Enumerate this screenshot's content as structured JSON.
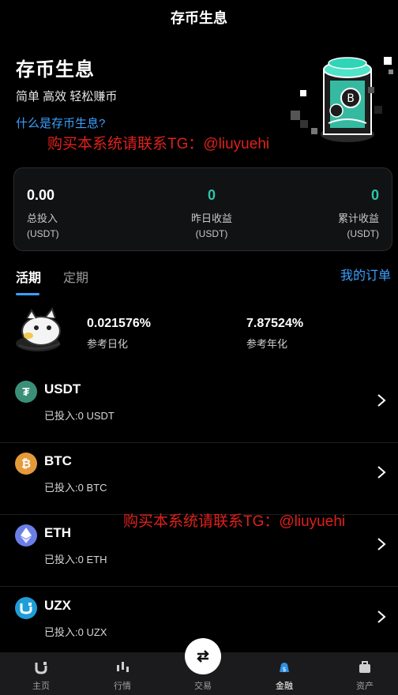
{
  "header": {
    "title": "存币生息"
  },
  "hero": {
    "title": "存币生息",
    "subtitle": "简单 高效 轻松赚币",
    "link": "什么是存币生息?",
    "watermark": "购买本系统请联系TG：@liuyuehi"
  },
  "stats": [
    {
      "value": "0.00",
      "label": "总投入",
      "unit": "(USDT)"
    },
    {
      "value": "0",
      "label": "昨日收益",
      "unit": "(USDT)"
    },
    {
      "value": "0",
      "label": "累计收益",
      "unit": "(USDT)"
    }
  ],
  "tabs": [
    {
      "label": "活期",
      "active": true
    },
    {
      "label": "定期",
      "active": false
    }
  ],
  "orders_link": "我的订单",
  "rates": [
    {
      "value": "0.021576%",
      "label": "参考日化"
    },
    {
      "value": "7.87524%",
      "label": "参考年化"
    }
  ],
  "coins": [
    {
      "name": "USDT",
      "invested": "已投入:0 USDT",
      "icon": "tether-icon",
      "color": "#3b8f78"
    },
    {
      "name": "BTC",
      "invested": "已投入:0 BTC",
      "icon": "bitcoin-icon",
      "color": "#e59a3a"
    },
    {
      "name": "ETH",
      "invested": "已投入:0 ETH",
      "icon": "ethereum-icon",
      "color": "#6b7ee6"
    },
    {
      "name": "UZX",
      "invested": "已投入:0 UZX",
      "icon": "uzx-icon",
      "color": "#1e9ed8"
    }
  ],
  "watermark2": "购买本系统请联系TG：@liuyuehi",
  "nav": [
    {
      "label": "主页",
      "icon": "home-icon"
    },
    {
      "label": "行情",
      "icon": "market-icon"
    },
    {
      "label": "交易",
      "icon": "trade-icon"
    },
    {
      "label": "金融",
      "icon": "finance-icon",
      "active": true
    },
    {
      "label": "资产",
      "icon": "wallet-icon"
    }
  ],
  "colors": {
    "accent": "#3aa0ff",
    "positive": "#2ec4a8",
    "watermark": "#e0201b"
  }
}
